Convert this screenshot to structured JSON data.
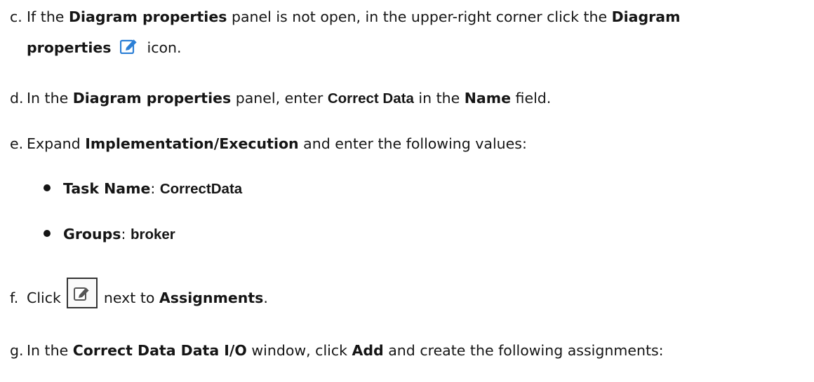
{
  "steps": [
    {
      "marker": "c.",
      "pre": "If the ",
      "bold1": "Diagram properties",
      "mid": " panel is not open, in the upper-right corner click the ",
      "bold2": "Diagram",
      "line2_bold": "properties",
      "line2_post": " icon."
    },
    {
      "marker": "d.",
      "pre": "In the ",
      "bold1": "Diagram properties",
      "mid": " panel, enter ",
      "value": "Correct Data",
      "mid2": " in the ",
      "bold2": "Name",
      "post": " field."
    },
    {
      "marker": "e.",
      "pre": "Expand ",
      "bold1": "Implementation/Execution",
      "post": " and enter the following values:"
    },
    {
      "marker": "f.",
      "pre": "Click ",
      "post": " next to ",
      "bold1": "Assignments",
      "tail": "."
    },
    {
      "marker": "g.",
      "pre": "In the ",
      "bold1": "Correct Data Data I/O",
      "mid": " window, click ",
      "bold2": "Add",
      "post": " and create the following assignments:"
    }
  ],
  "bullets": [
    {
      "label": "Task Name",
      "sep": ": ",
      "value": "CorrectData"
    },
    {
      "label": "Groups",
      "sep": ": ",
      "value": "broker"
    }
  ],
  "icons": {
    "diagram_properties_icon": "edit-icon",
    "assignments_button_icon": "edit-icon",
    "accent": "#2b7fd6"
  }
}
